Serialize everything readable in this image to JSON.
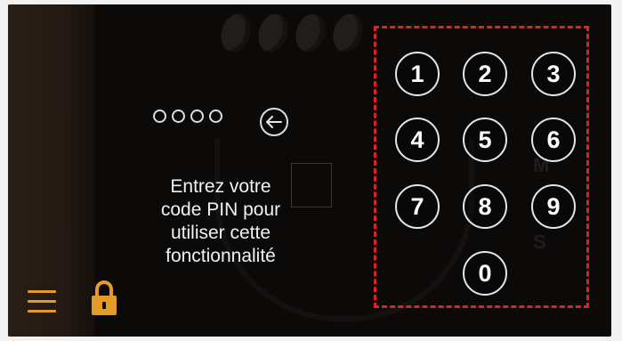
{
  "pin": {
    "dots": 4,
    "backspace_icon": "arrow-left-icon"
  },
  "message": {
    "lines": [
      "Entrez votre",
      "code PIN pour",
      "utiliser cette",
      "fonctionnalité"
    ]
  },
  "keypad": {
    "keys": [
      "1",
      "2",
      "3",
      "4",
      "5",
      "6",
      "7",
      "8",
      "9",
      "0"
    ]
  },
  "bottom_bar": {
    "menu_icon": "hamburger-menu-icon",
    "lock_icon": "lock-icon"
  },
  "colors": {
    "accent_orange": "#e39a26",
    "keypad_highlight": "#e0212a",
    "background": "#0c0a09"
  }
}
